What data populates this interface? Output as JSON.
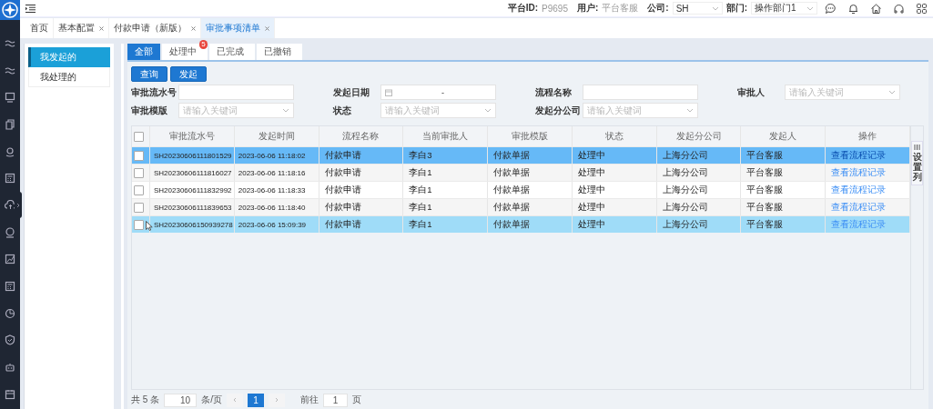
{
  "topbar": {
    "platform_id_label": "平台ID:",
    "platform_id": "P9695",
    "user_label": "用户:",
    "user": "平台客服",
    "company_label": "公司:",
    "company": "SH",
    "department_label": "部门:",
    "department": "操作部门1"
  },
  "page_tabs": [
    {
      "label": "首页",
      "closable": false,
      "selected": false
    },
    {
      "label": "基本配置",
      "closable": true,
      "selected": false
    },
    {
      "label": "付款申请（新版）",
      "closable": true,
      "selected": false
    },
    {
      "label": "审批事项清单",
      "closable": true,
      "selected": true
    }
  ],
  "side_menu": [
    {
      "label": "我发起的",
      "selected": true
    },
    {
      "label": "我处理的",
      "selected": false
    }
  ],
  "status_tabs": [
    {
      "label": "全部",
      "selected": true
    },
    {
      "label": "处理中",
      "badge": "5",
      "selected": false
    },
    {
      "label": "已完成",
      "selected": false
    },
    {
      "label": "已撤销",
      "selected": false
    }
  ],
  "buttons": [
    "查询",
    "发起"
  ],
  "filters": [
    {
      "label": "审批流水号",
      "kind": "text"
    },
    {
      "label": "发起日期",
      "kind": "daterange",
      "separator": "-"
    },
    {
      "label": "流程名称",
      "kind": "text"
    },
    {
      "label": "审批人",
      "kind": "select",
      "placeholder": "请输入关键词"
    },
    {
      "label": "审批模版",
      "kind": "select",
      "placeholder": "请输入关键词"
    },
    {
      "label": "状态",
      "kind": "select",
      "placeholder": "请输入关键词"
    },
    {
      "label": "发起分公司",
      "kind": "select",
      "placeholder": "请输入关键词"
    }
  ],
  "table": {
    "header_checked": false,
    "columns": [
      "审批流水号",
      "发起时间",
      "流程名称",
      "当前审批人",
      "审批模版",
      "状态",
      "发起分公司",
      "发起人",
      "操作"
    ],
    "rows": [
      {
        "checked": false,
        "selected": true,
        "hovered": false,
        "cells": [
          "SH20230606111801529",
          "2023-06-06 11:18:02",
          "付款申请",
          "李白3",
          "付款单据",
          "处理中",
          "上海分公司",
          "平台客服",
          "查看流程记录"
        ]
      },
      {
        "checked": false,
        "selected": false,
        "hovered": false,
        "cells": [
          "SH20230606111816027",
          "2023-06-06 11:18:16",
          "付款申请",
          "李白1",
          "付款单据",
          "处理中",
          "上海分公司",
          "平台客服",
          "查看流程记录"
        ]
      },
      {
        "checked": false,
        "selected": false,
        "hovered": false,
        "cells": [
          "SH20230606111832992",
          "2023-06-06 11:18:33",
          "付款申请",
          "李白1",
          "付款单据",
          "处理中",
          "上海分公司",
          "平台客服",
          "查看流程记录"
        ]
      },
      {
        "checked": false,
        "selected": false,
        "hovered": false,
        "cells": [
          "SH20230606111839653",
          "2023-06-06 11:18:40",
          "付款申请",
          "李白1",
          "付款单据",
          "处理中",
          "上海分公司",
          "平台客服",
          "查看流程记录"
        ]
      },
      {
        "checked": false,
        "selected": false,
        "hovered": true,
        "cells": [
          "SH20230606150939278",
          "2023-06-06 15:09:39",
          "付款申请",
          "李白1",
          "付款单据",
          "处理中",
          "上海分公司",
          "平台客服",
          "查看流程记录"
        ]
      }
    ]
  },
  "column_settings": "设置列",
  "pagination": {
    "total": "共 5 条",
    "page_size": "10",
    "page_size_unit": "条/页",
    "pages": [
      {
        "label": "1",
        "selected": true
      }
    ],
    "goto_label": "前往",
    "goto_value": "1",
    "goto_unit": "页"
  }
}
